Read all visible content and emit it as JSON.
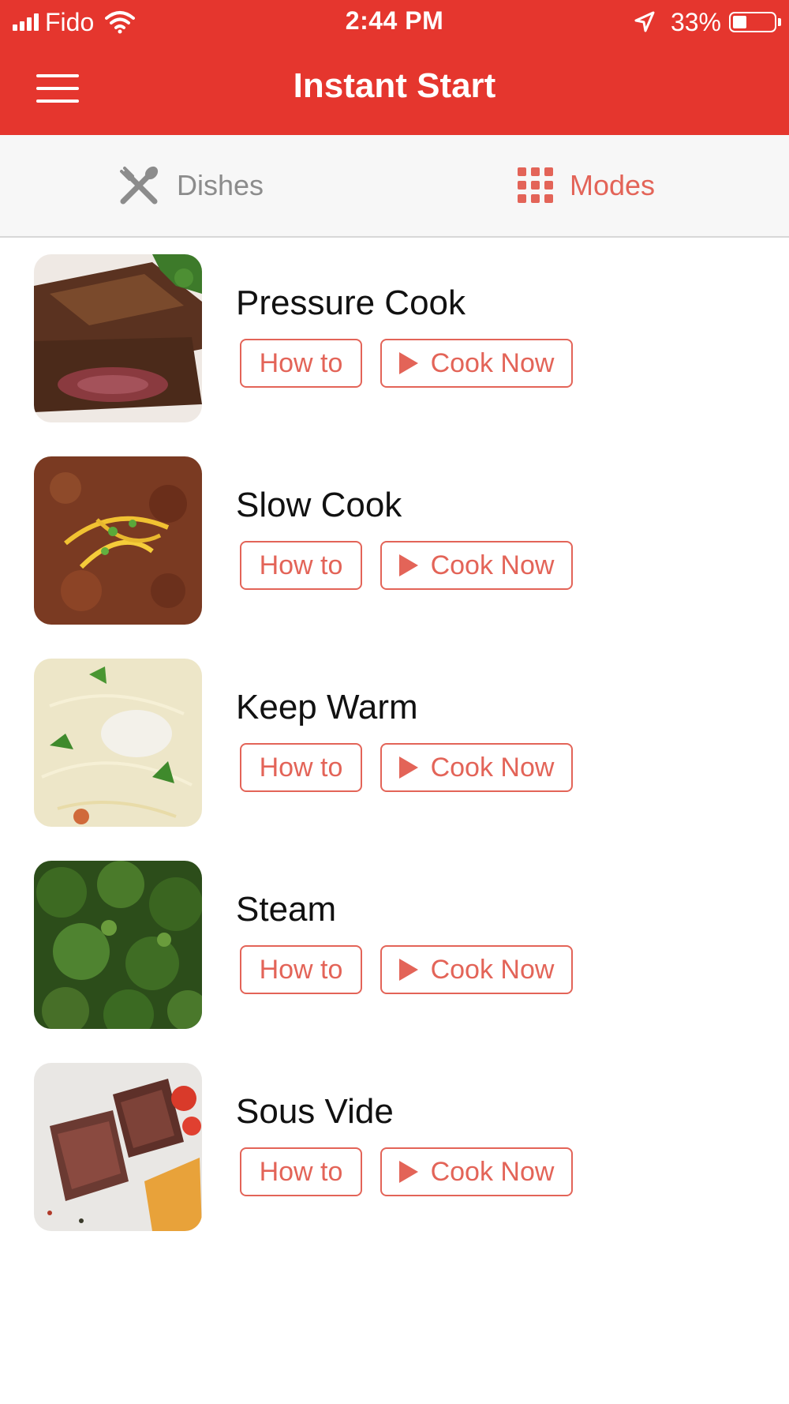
{
  "status_bar": {
    "carrier": "Fido",
    "time": "2:44 PM",
    "battery_percent": "33%",
    "battery_level": 0.33
  },
  "nav": {
    "title": "Instant Start"
  },
  "tabs": [
    {
      "label": "Dishes",
      "icon": "fork-spoon-icon",
      "active": false
    },
    {
      "label": "Modes",
      "icon": "grid-icon",
      "active": true
    }
  ],
  "modes": [
    {
      "name": "Pressure Cook",
      "how_to_label": "How to",
      "cook_now_label": "Cook Now",
      "thumbnail": "ribs"
    },
    {
      "name": "Slow Cook",
      "how_to_label": "How to",
      "cook_now_label": "Cook Now",
      "thumbnail": "chili"
    },
    {
      "name": "Keep Warm",
      "how_to_label": "How to",
      "cook_now_label": "Cook Now",
      "thumbnail": "noodle-soup"
    },
    {
      "name": "Steam",
      "how_to_label": "How to",
      "cook_now_label": "Cook Now",
      "thumbnail": "broccoli"
    },
    {
      "name": "Sous Vide",
      "how_to_label": "How to",
      "cook_now_label": "Cook Now",
      "thumbnail": "steak"
    }
  ],
  "colors": {
    "header": "#e5362e",
    "accent": "#e36458",
    "tab_bar": "#f7f7f7",
    "inactive_tab": "#8c8c8c"
  }
}
